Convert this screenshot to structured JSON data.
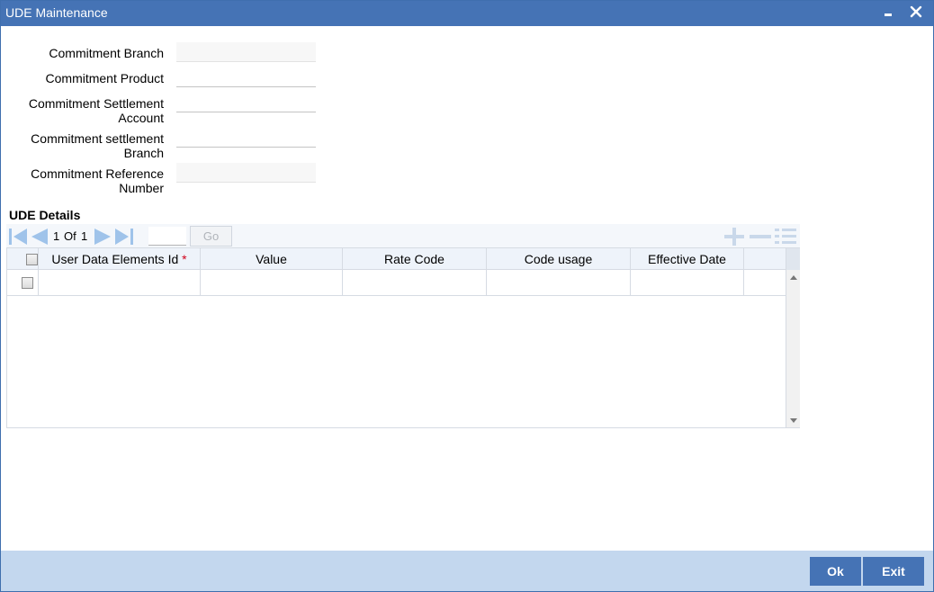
{
  "window": {
    "title": "UDE Maintenance"
  },
  "form": {
    "commitment_branch": {
      "label": "Commitment Branch",
      "value": ""
    },
    "commitment_product": {
      "label": "Commitment Product",
      "value": ""
    },
    "commitment_settlement_account": {
      "label_line1": "Commitment Settlement",
      "label_line2": "Account",
      "value": ""
    },
    "commitment_settlement_branch": {
      "label_line1": "Commitment settlement",
      "label_line2": "Branch",
      "value": ""
    },
    "commitment_reference_number": {
      "label_line1": "Commitment Reference",
      "label_line2": "Number",
      "value": ""
    }
  },
  "ude_details": {
    "title": "UDE Details",
    "pager": {
      "current": "1",
      "of_label": "Of",
      "total": "1",
      "go_label": "Go",
      "page_input": ""
    },
    "columns": {
      "udeid": "User Data Elements Id",
      "required_mark": "*",
      "value": "Value",
      "rate_code": "Rate Code",
      "code_usage": "Code usage",
      "effective_date": "Effective Date"
    },
    "rows": [
      {
        "udeid": "",
        "value": "",
        "rate_code": "",
        "code_usage": "",
        "effective_date": ""
      }
    ]
  },
  "footer": {
    "ok_label": "Ok",
    "exit_label": "Exit"
  },
  "colors": {
    "titlebar": "#4573b5",
    "footer": "#c3d7ee",
    "button": "#4573b5",
    "required": "#d0021b",
    "nav_icon": "#9fc3ea"
  }
}
